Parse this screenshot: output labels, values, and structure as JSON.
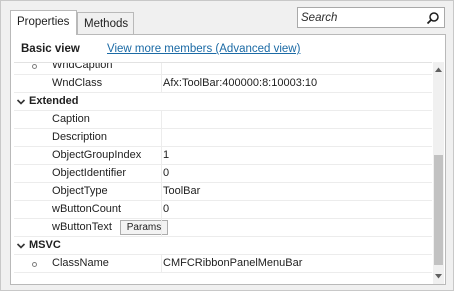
{
  "tabs": [
    {
      "label": "Properties",
      "active": true
    },
    {
      "label": "Methods",
      "active": false
    }
  ],
  "search": {
    "placeholder": "Search",
    "value": "",
    "icon": "search-icon"
  },
  "header": {
    "view_label": "Basic view",
    "more_link": "View more members (Advanced view)"
  },
  "rows": {
    "wndcaption": {
      "name": "WndCaption",
      "value": ""
    },
    "wndclass": {
      "name": "WndClass",
      "value": "Afx:ToolBar:400000:8:10003:10"
    },
    "extended_group": "Extended",
    "caption": {
      "name": "Caption",
      "value": ""
    },
    "description": {
      "name": "Description",
      "value": ""
    },
    "objectgroupindex": {
      "name": "ObjectGroupIndex",
      "value": "1"
    },
    "objectidentifier": {
      "name": "ObjectIdentifier",
      "value": "0"
    },
    "objecttype": {
      "name": "ObjectType",
      "value": "ToolBar"
    },
    "wbuttoncount": {
      "name": "wButtonCount",
      "value": "0"
    },
    "wbuttontext": {
      "name": "wButtonText",
      "button": "Params"
    },
    "msvc_group": "MSVC",
    "classname": {
      "name": "ClassName",
      "value": "CMFCRibbonPanelMenuBar"
    }
  },
  "colors": {
    "link": "#1b6aa5",
    "scroll_thumb": "#c2c2c2",
    "border": "#b9b9b9"
  }
}
